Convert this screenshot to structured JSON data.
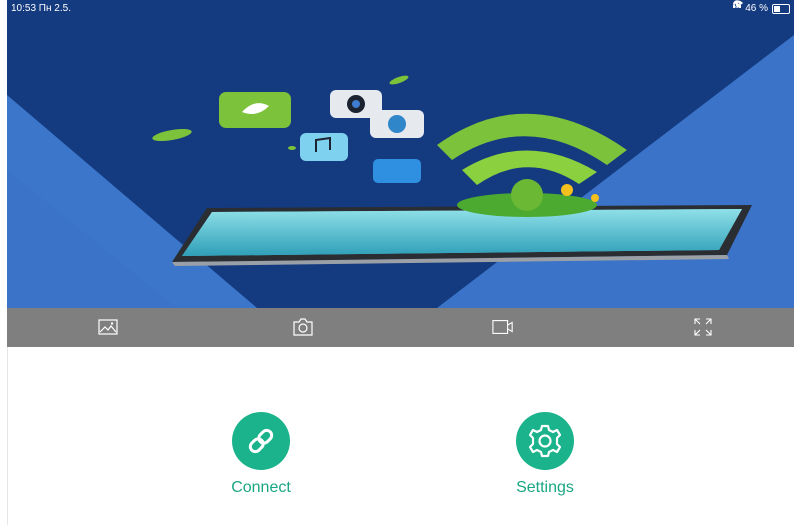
{
  "status_bar": {
    "time_date": "10:53  Пн 2.5.",
    "battery_percent_label": "46 %",
    "battery_level": 0.46,
    "icons": [
      "wifi-icon",
      "location-icon",
      "headphones-icon",
      "battery-icon"
    ]
  },
  "hero": {
    "description_icons": [
      "leaf-app-icon",
      "camera-app-icon",
      "globe-app-icon",
      "music-app-icon",
      "weather-app-icon",
      "wifi-signal-graphic",
      "tablet-graphic"
    ]
  },
  "toolbar": {
    "buttons": [
      {
        "name": "album",
        "icon": "image-icon"
      },
      {
        "name": "snapshot",
        "icon": "camera-icon"
      },
      {
        "name": "record",
        "icon": "video-icon"
      },
      {
        "name": "fullscreen",
        "icon": "expand-icon"
      }
    ]
  },
  "actions": {
    "connect_label": "Connect",
    "settings_label": "Settings"
  },
  "colors": {
    "accent": "#1ab38b",
    "accent_text": "#1aa684",
    "toolbar_bg": "#7f7f7f",
    "hero_dark": "#14367a",
    "hero_light": "#3a73c7"
  }
}
